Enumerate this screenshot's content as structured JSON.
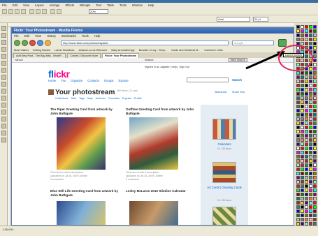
{
  "corel": {
    "menu": [
      "File",
      "Edit",
      "View",
      "Layout",
      "Arrange",
      "Effects",
      "Bitmaps",
      "Text",
      "Table",
      "Tools",
      "Window",
      "Help"
    ],
    "zoom": "20%",
    "font_name": "Arial",
    "font_size": "24 pt",
    "status": "-135,000 ."
  },
  "firefox": {
    "title": "Flickr: Your Photostream - Mozilla Firefox",
    "menu": [
      "File",
      "Edit",
      "View",
      "History",
      "Bookmarks",
      "Tools",
      "Help"
    ],
    "url": "http://www.flickr.com/photos/bayatta/",
    "search_placeholder": "Google",
    "launch_tooltip": "Launch Corkes",
    "bookmarks": [
      "Most Visited",
      "Getting Started",
      "Latest Headlines",
      "Amazon.co.uk Welcome",
      "Baby Aromatherapy",
      "Bundles of Joy - Shop...",
      "Cards and Medieval M...",
      "Cuetomer Links"
    ],
    "tabs": [
      "Add New Post - The Bay Attic - WordP...",
      "Corkes / Discover More",
      "Flickr: Your Photostream"
    ],
    "yahoo": {
      "label": "Yahoo!",
      "search": "Search:",
      "web_search": "Web Search"
    }
  },
  "flickr": {
    "signed_in": "Signed in as Jagtatte | Help | Sign Out",
    "nav": [
      "Home",
      "You",
      "Organize",
      "Contacts",
      "Groups",
      "Explore"
    ],
    "search_label": "Search",
    "page_title": "Your photostream",
    "meta": "460 items | 11 sets",
    "subnav": [
      "Collections",
      "Sets",
      "Tags",
      "Map",
      "Archives",
      "Favorites",
      "Popular",
      "Profile"
    ],
    "slideshow": "Slideshow",
    "share": "Share This",
    "photos": [
      {
        "title": "The Piper Greeting Card from artwork by John Bathgate",
        "meta": "Click here to add a description",
        "uploaded": "Uploaded on Jul 16, 2009 | Delete",
        "comments": "0 comments"
      },
      {
        "title": "Outflow Greeting Card from artwork by John Bathgate",
        "meta": "Click here to add a description",
        "uploaded": "Uploaded on Jul 16, 2009 | Delete",
        "comments": "0 comments"
      },
      {
        "title": "Blue Still Life Greeting Card from artwork by John Bathgate"
      },
      {
        "title": "Lesley McLaren 2010 Slimline Calendar"
      }
    ],
    "sets": [
      {
        "name": "Calendars",
        "count": "Ca 138 Items"
      },
      {
        "name": "Art Cards | Greeting Cards",
        "count": "Ca 138 Items"
      }
    ]
  },
  "colors": {
    "flickr_blue": "#0063dc",
    "flickr_pink": "#ff0084",
    "highlight_circle": "#e0245e"
  }
}
